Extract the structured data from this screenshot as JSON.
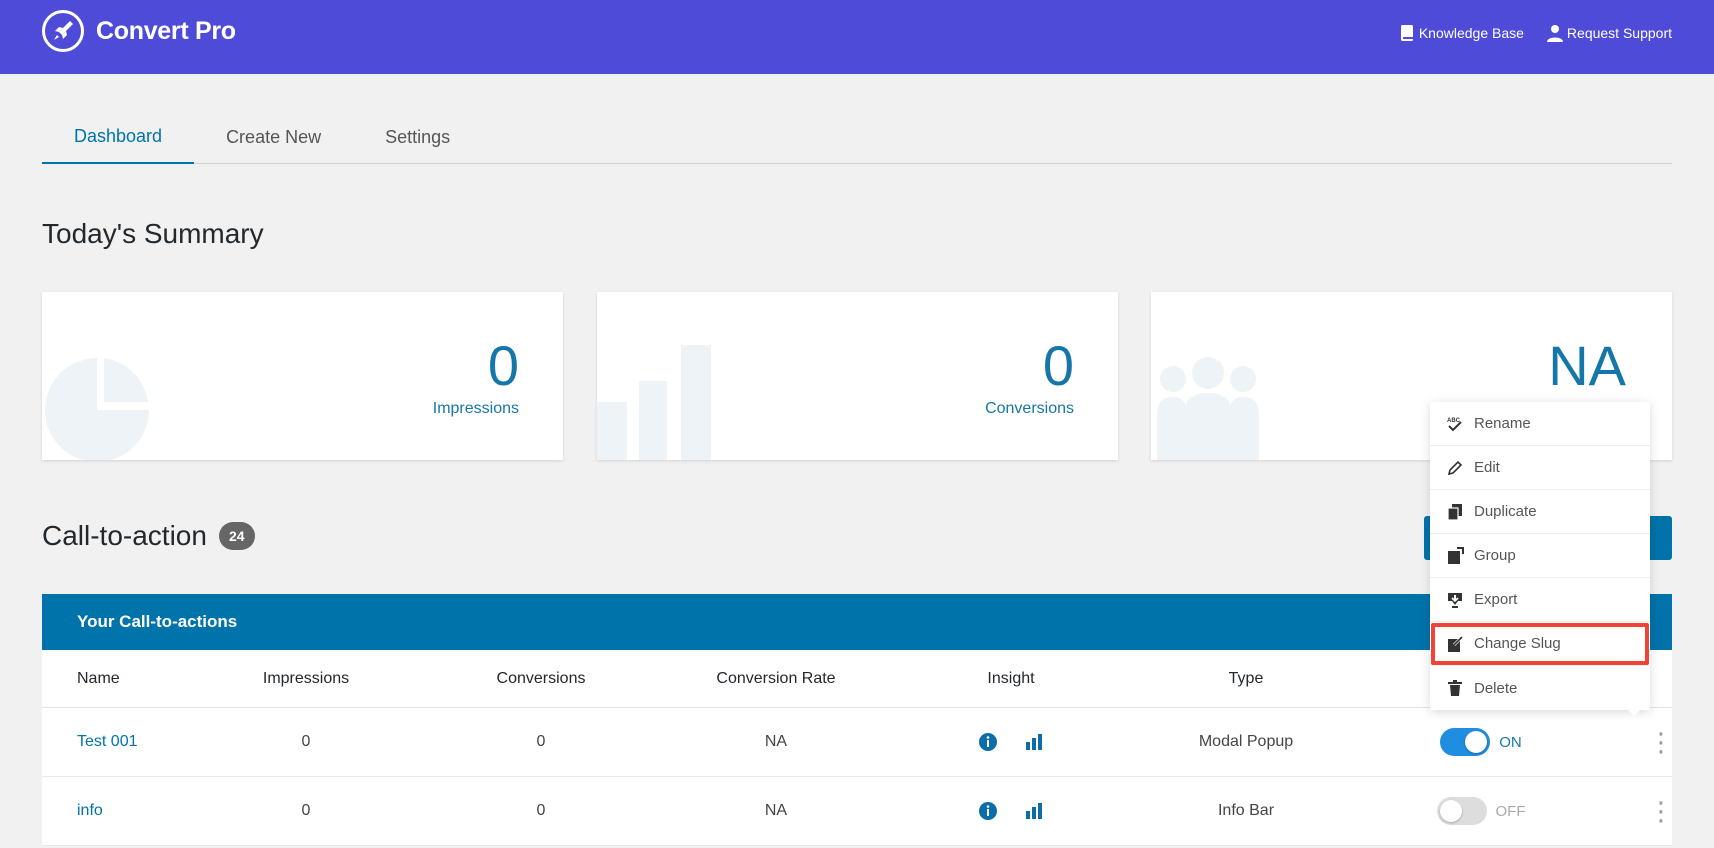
{
  "header": {
    "app_name": "Convert Pro",
    "links": {
      "knowledge_base": "Knowledge Base",
      "request_support": "Request Support"
    }
  },
  "tabs": {
    "dashboard": "Dashboard",
    "create_new": "Create New",
    "settings": "Settings"
  },
  "summary": {
    "title": "Today's Summary",
    "impressions": {
      "value": "0",
      "label": "Impressions"
    },
    "conversions": {
      "value": "0",
      "label": "Conversions"
    },
    "rate": {
      "value": "NA"
    }
  },
  "cta": {
    "title": "Call-to-action",
    "count": "24"
  },
  "table": {
    "header": "Your Call-to-actions",
    "columns": {
      "name": "Name",
      "impressions": "Impressions",
      "conversions": "Conversions",
      "rate": "Conversion Rate",
      "insight": "Insight",
      "type": "Type"
    },
    "rows": [
      {
        "name": "Test 001",
        "impressions": "0",
        "conversions": "0",
        "rate": "NA",
        "type": "Modal Popup",
        "status": "ON"
      },
      {
        "name": "info",
        "impressions": "0",
        "conversions": "0",
        "rate": "NA",
        "type": "Info Bar",
        "status": "OFF"
      }
    ]
  },
  "menu": {
    "rename": "Rename",
    "edit": "Edit",
    "duplicate": "Duplicate",
    "group": "Group",
    "export": "Export",
    "change_slug": "Change Slug",
    "delete": "Delete"
  },
  "colors": {
    "brand": "#4d4bd8",
    "primary": "#0073aa",
    "toggle_on": "#1f8de0",
    "highlight": "#f04437"
  }
}
